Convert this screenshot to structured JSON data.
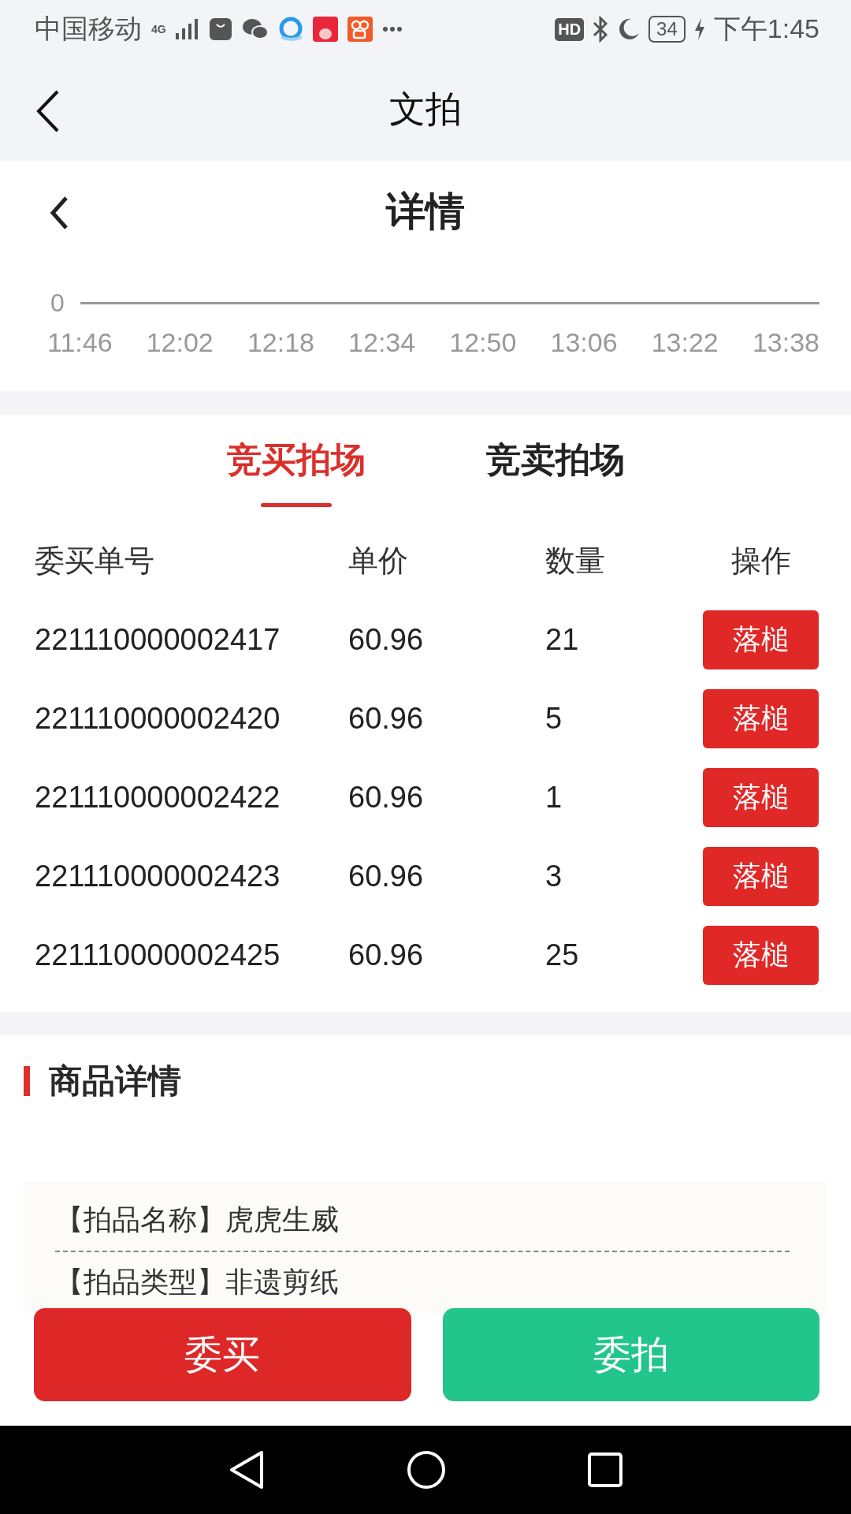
{
  "status_bar": {
    "carrier": "中国移动",
    "network": "4G",
    "hd": "HD",
    "battery": "34",
    "time": "下午1:45"
  },
  "app_bar": {
    "title": "文拍"
  },
  "page_header": {
    "title": "详情"
  },
  "chart": {
    "y_tick": "0",
    "x_labels": [
      "11:46",
      "12:02",
      "12:18",
      "12:34",
      "12:50",
      "13:06",
      "13:22",
      "13:38"
    ]
  },
  "tabs": [
    {
      "label": "竞买拍场",
      "selected": true
    },
    {
      "label": "竞卖拍场",
      "selected": false
    }
  ],
  "table": {
    "columns": [
      "委买单号",
      "单价",
      "数量",
      "操作"
    ],
    "rows": [
      {
        "order_no": "221110000002417",
        "price": "60.96",
        "quantity": "21",
        "action": "落槌"
      },
      {
        "order_no": "221110000002420",
        "price": "60.96",
        "quantity": "5",
        "action": "落槌"
      },
      {
        "order_no": "221110000002422",
        "price": "60.96",
        "quantity": "1",
        "action": "落槌"
      },
      {
        "order_no": "221110000002423",
        "price": "60.96",
        "quantity": "3",
        "action": "落槌"
      },
      {
        "order_no": "221110000002425",
        "price": "60.96",
        "quantity": "25",
        "action": "落槌"
      }
    ]
  },
  "goods_detail": {
    "title": "商品详情",
    "rows": [
      {
        "label": "【拍品名称】",
        "value": "虎虎生威"
      },
      {
        "label": "【拍品类型】",
        "value": "非遗剪纸"
      }
    ]
  },
  "actions": [
    {
      "label": "委买",
      "kind": "buy"
    },
    {
      "label": "委拍",
      "kind": "sell"
    }
  ]
}
